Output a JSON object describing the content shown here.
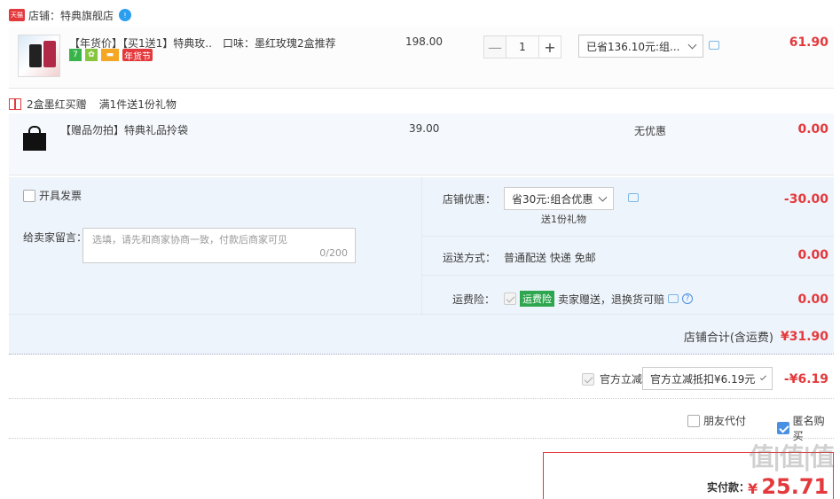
{
  "shop": {
    "badge": "天猫",
    "label": "店铺：",
    "name": "特典旗舰店",
    "wang": "!"
  },
  "item": {
    "title": "【年货价】【买1送1】特典玫...",
    "flavor": "口味：墨红玫瑰2盒推荐",
    "price": "198.00",
    "qty": "1",
    "minus": "—",
    "plus": "+",
    "discount_select": "已省136.10元:组...",
    "subtotal": "61.90",
    "badge_7": "7",
    "badge_newyear": "年货节"
  },
  "gift_bar": {
    "title": "2盒墨红买赠",
    "rule": "满1件送1份礼物"
  },
  "gift_item": {
    "title": "【赠品勿拍】特典礼品拎袋",
    "price": "39.00",
    "discount": "无优惠",
    "subtotal": "0.00"
  },
  "invoice": {
    "label": "开具发票"
  },
  "message": {
    "label": "给卖家留言：",
    "placeholder": "选填，请先和商家协商一致，付款后商家可见",
    "counter": "0/200"
  },
  "shop_discount": {
    "label": "店铺优惠：",
    "select": "省30元:组合优惠",
    "note": "送1份礼物",
    "amount": "-30.00"
  },
  "shipping": {
    "label": "运送方式：",
    "value": "普通配送 快递 免邮",
    "amount": "0.00"
  },
  "insurance": {
    "label": "运费险：",
    "tag": "运费险",
    "desc": "卖家赠送，退换货可赔",
    "amount": "0.00",
    "q": "?"
  },
  "shop_total": {
    "label": "店铺合计(含运费)",
    "amount": "¥31.90"
  },
  "official": {
    "label": "官方立减",
    "select": "官方立减抵扣¥6.19元",
    "amount": "-¥6.19"
  },
  "options": {
    "friend_pay": "朋友代付",
    "anonymous": "匿名购买"
  },
  "payment": {
    "label": "实付款：",
    "currency": "¥",
    "amount": "25.71"
  },
  "watermark": "值|值|值",
  "colors": {
    "accent": "#e4393c",
    "panel": "#eef4fb",
    "tag_green": "#2da64f"
  }
}
